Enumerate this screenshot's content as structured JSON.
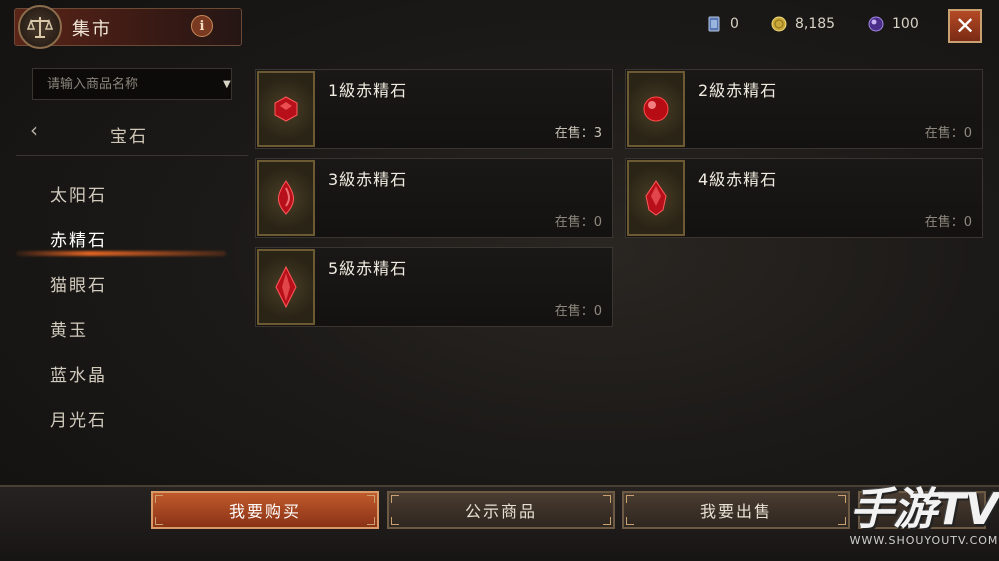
{
  "header": {
    "title": "集市",
    "info_label": "i",
    "currencies": [
      {
        "icon": "card-icon",
        "value": "0",
        "color": "#8aa6d8"
      },
      {
        "icon": "gold-coin-icon",
        "value": "8,185",
        "color": "#d8b84a"
      },
      {
        "icon": "purple-orb-icon",
        "value": "100",
        "color": "#8a6ad8"
      }
    ],
    "close_label": "✕"
  },
  "sidebar": {
    "search_placeholder": "请输入商品名称",
    "category_title": "宝石",
    "items": [
      {
        "label": "太阳石",
        "active": false
      },
      {
        "label": "赤精石",
        "active": true
      },
      {
        "label": "猫眼石",
        "active": false
      },
      {
        "label": "黄玉",
        "active": false
      },
      {
        "label": "蓝水晶",
        "active": false
      },
      {
        "label": "月光石",
        "active": false
      }
    ]
  },
  "items": [
    {
      "name": "1級赤精石",
      "stock_label": "在售：3",
      "gem": "round"
    },
    {
      "name": "2級赤精石",
      "stock_label": "在售：0",
      "gem": "sphere"
    },
    {
      "name": "3級赤精石",
      "stock_label": "在售：0",
      "gem": "drop"
    },
    {
      "name": "4級赤精石",
      "stock_label": "在售：0",
      "gem": "faceted-drop"
    },
    {
      "name": "5級赤精石",
      "stock_label": "在售：0",
      "gem": "marquise"
    }
  ],
  "bottom": {
    "buy_label": "我要购买",
    "public_label": "公示商品",
    "sell_label": "我要出售"
  },
  "watermark": {
    "main": "手游TV",
    "sub": "WWW.SHOUYOUTV.COM"
  },
  "colors": {
    "accent": "#c05a2c",
    "gem_red": "#c8141c",
    "gold_border": "#6c5a32"
  }
}
